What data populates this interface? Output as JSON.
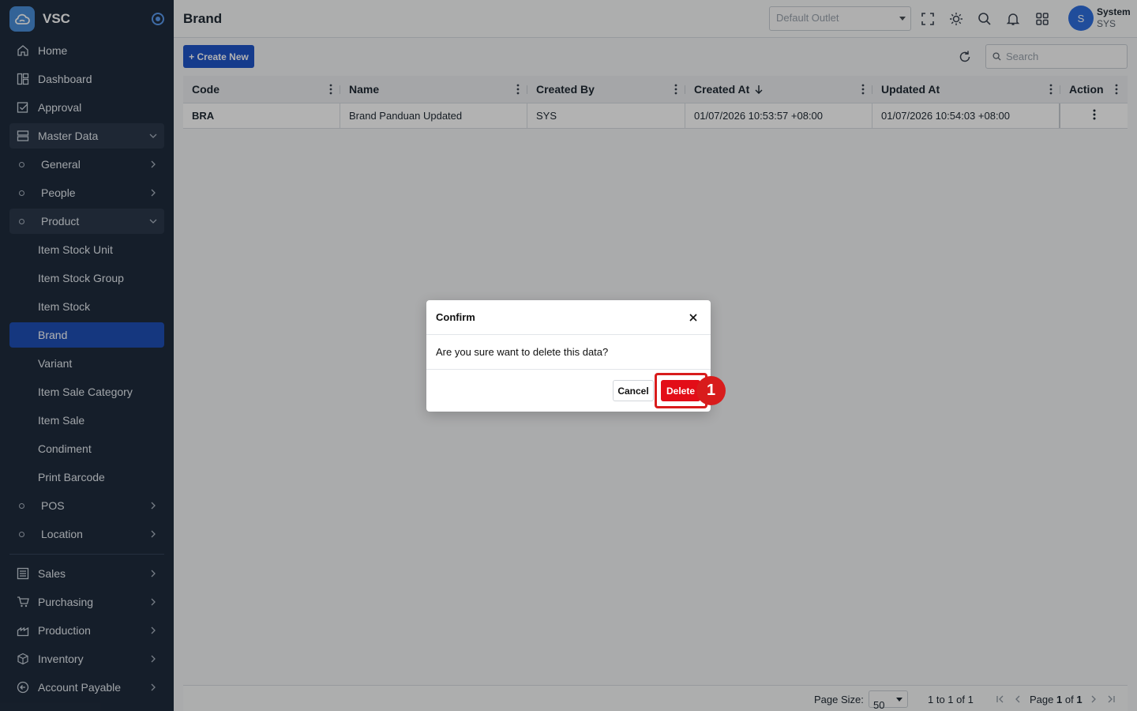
{
  "app": {
    "name": "VSC"
  },
  "sidebar": {
    "items": [
      {
        "label": "Home",
        "icon": "home-icon"
      },
      {
        "label": "Dashboard",
        "icon": "dashboard-icon"
      },
      {
        "label": "Approval",
        "icon": "approval-icon"
      },
      {
        "label": "Master Data",
        "icon": "server-icon",
        "expanded": true
      },
      {
        "label": "General"
      },
      {
        "label": "People"
      },
      {
        "label": "Product",
        "expanded": true
      },
      {
        "label": "Item Stock Unit"
      },
      {
        "label": "Item Stock Group"
      },
      {
        "label": "Item Stock"
      },
      {
        "label": "Brand",
        "active": true
      },
      {
        "label": "Variant"
      },
      {
        "label": "Item Sale Category"
      },
      {
        "label": "Item Sale"
      },
      {
        "label": "Condiment"
      },
      {
        "label": "Print Barcode"
      },
      {
        "label": "POS"
      },
      {
        "label": "Location"
      }
    ],
    "modules": [
      {
        "label": "Sales",
        "icon": "list-icon"
      },
      {
        "label": "Purchasing",
        "icon": "cart-icon"
      },
      {
        "label": "Production",
        "icon": "factory-icon"
      },
      {
        "label": "Inventory",
        "icon": "box-icon"
      },
      {
        "label": "Account Payable",
        "icon": "arrow-circle-icon"
      }
    ]
  },
  "header": {
    "title": "Brand",
    "outlet_placeholder": "Default Outlet",
    "user": {
      "initial": "S",
      "name": "System",
      "code": "SYS"
    }
  },
  "toolbar": {
    "create_label": "+ Create New",
    "search_placeholder": "Search"
  },
  "table": {
    "columns": [
      "Code",
      "Name",
      "Created By",
      "Created At",
      "Updated At",
      "Action"
    ],
    "sorted_column": "Created At",
    "sort_direction": "desc",
    "rows": [
      {
        "code": "BRA",
        "name": "Brand Panduan Updated",
        "created_by": "SYS",
        "created_at": "01/07/2026 10:53:57 +08:00",
        "updated_at": "01/07/2026 10:54:03 +08:00"
      }
    ]
  },
  "pagination": {
    "page_size_label": "Page Size:",
    "page_size": "50",
    "range": "1 to 1 of 1",
    "page_prefix": "Page",
    "page": "1",
    "of_label": "of",
    "total_pages": "1"
  },
  "dialog": {
    "title": "Confirm",
    "message": "Are you sure want to delete this data?",
    "cancel_label": "Cancel",
    "delete_label": "Delete"
  },
  "annotation": {
    "step": "1",
    "color": "#d81c1c"
  },
  "colors": {
    "sidebar_bg": "#1f2c3d",
    "primary": "#1f55c9",
    "danger": "#e30d17"
  }
}
